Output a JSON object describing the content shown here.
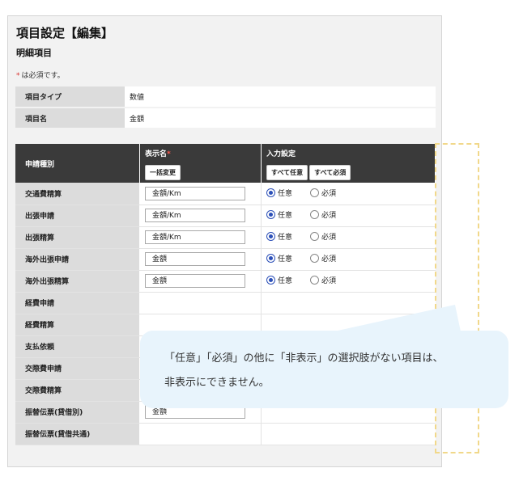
{
  "page": {
    "title": "項目設定【編集】",
    "subtitle": "明細項目",
    "required_note_mark": "*",
    "required_note": "は必須です。"
  },
  "info": {
    "rows": [
      {
        "label": "項目タイプ",
        "value": "数値"
      },
      {
        "label": "項目名",
        "value": "金額"
      }
    ]
  },
  "grid": {
    "headers": {
      "type": "申請種別",
      "display_name": "表示名",
      "required_mark": "*",
      "input_setting": "入力設定"
    },
    "buttons": {
      "bulk_change": "一括変更",
      "all_optional": "すべて任意",
      "all_required": "すべて必須"
    },
    "radio_labels": {
      "optional": "任意",
      "required": "必須"
    },
    "rows": [
      {
        "type": "交通費精算",
        "name": "金額/Km",
        "setting": "任意"
      },
      {
        "type": "出張申請",
        "name": "金額/Km",
        "setting": "任意"
      },
      {
        "type": "出張精算",
        "name": "金額/Km",
        "setting": "任意"
      },
      {
        "type": "海外出張申請",
        "name": "金額",
        "setting": "任意"
      },
      {
        "type": "海外出張精算",
        "name": "金額",
        "setting": "任意"
      },
      {
        "type": "経費申請",
        "name": null,
        "setting": null
      },
      {
        "type": "経費精算",
        "name": null,
        "setting": null
      },
      {
        "type": "支払依頼",
        "name": null,
        "setting": null
      },
      {
        "type": "交際費申請",
        "name": null,
        "setting": null
      },
      {
        "type": "交際費精算",
        "name": null,
        "setting": null
      },
      {
        "type": "振替伝票(貸借別)",
        "name": "金額",
        "setting": null
      },
      {
        "type": "振替伝票(貸借共通)",
        "name": null,
        "setting": null
      }
    ]
  },
  "callout": {
    "line1": "「任意」「必須」の他に「非表示」の選択肢がない項目は、",
    "line2": "非表示にできません。"
  },
  "colors": {
    "header_bg": "#3a3a3a",
    "label_bg": "#dcdcdc",
    "radio_selected": "#2b4fb8",
    "callout_bg": "#e8f4fc",
    "dashed_highlight": "#f1d88a",
    "required_mark": "#d9302c"
  }
}
